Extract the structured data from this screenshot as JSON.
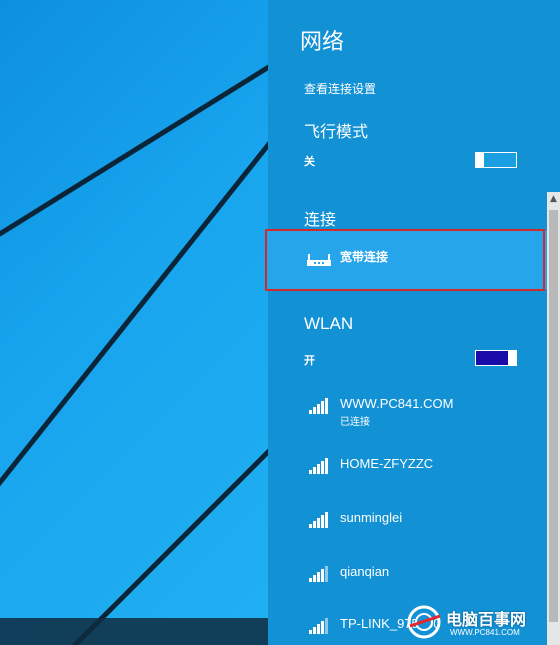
{
  "network_panel": {
    "title": "网络",
    "view_settings_link": "查看连接设置",
    "airplane_mode": {
      "title": "飞行模式",
      "state_label": "关",
      "enabled": false
    },
    "connections": {
      "title": "连接",
      "items": [
        {
          "label": "宽带连接",
          "highlighted": true
        }
      ]
    },
    "wlan": {
      "title": "WLAN",
      "state_label": "开",
      "enabled": true,
      "networks": [
        {
          "name": "WWW.PC841.COM",
          "status": "已连接",
          "signal_bars": 5
        },
        {
          "name": "HOME-ZFYZZC",
          "status": "",
          "signal_bars": 5
        },
        {
          "name": "sunminglei",
          "status": "",
          "signal_bars": 5
        },
        {
          "name": "qianqian",
          "status": "",
          "signal_bars": 4
        },
        {
          "name": "TP-LINK_975050",
          "status": "",
          "signal_bars": 4
        }
      ]
    }
  },
  "watermark": {
    "site_name": "电脑百事网",
    "url": "WWW.PC841.COM"
  },
  "colors": {
    "panel_bg": "#1292d5",
    "highlight_bg": "#26a5ea",
    "highlight_outline": "#d32a2a",
    "toggle_on": "#1a0aa8"
  },
  "icons": {
    "broadband": "router-icon",
    "wifi": "wifi-signal-icon",
    "scroll_up": "chevron-up-icon"
  }
}
